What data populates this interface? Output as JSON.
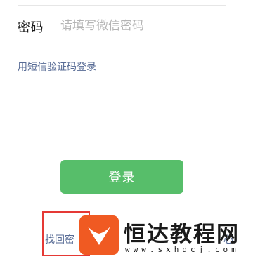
{
  "login_form": {
    "password_label": "密码",
    "password_placeholder": "请填写微信密码",
    "sms_login_link": "用短信验证码登录",
    "login_button": "登录",
    "recover_password_link": "找回密",
    "recover_tail": "心"
  },
  "watermark": {
    "title": "恒达教程网",
    "url": "www.sxhdcj.com"
  },
  "colors": {
    "accent_green": "#57be6a",
    "link_blue": "#576b95",
    "highlight_red": "#e53935",
    "logo_orange": "#f05a22"
  }
}
